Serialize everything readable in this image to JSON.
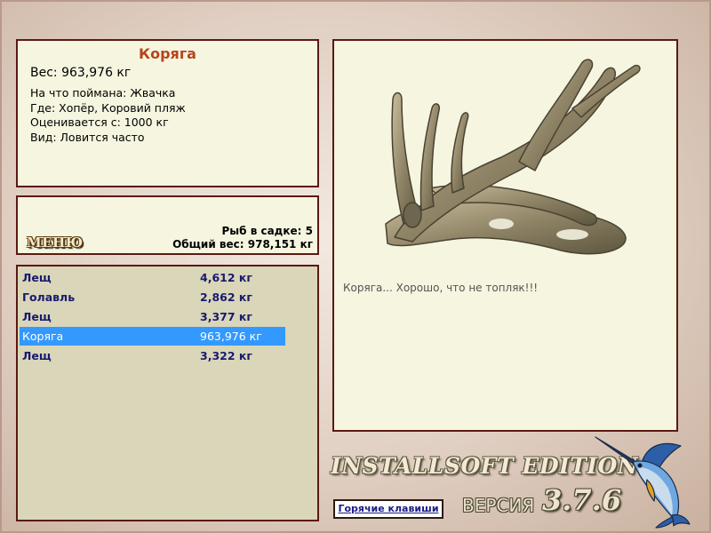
{
  "catch": {
    "title": "Коряга",
    "weight": "Вес: 963,976 кг",
    "caught_on": "На что поймана: Жвачка",
    "location": "Где: Хопёр, Коровий пляж",
    "value": "Оценивается с: 1000 кг",
    "kind": "Вид: Ловится часто"
  },
  "stats": {
    "menu_label": "МЕНЮ",
    "fish_count": "Рыб в садке: 5",
    "total_weight": "Общий вес: 978,151 кг"
  },
  "fish_list": [
    {
      "name": "Лещ",
      "weight": "4,612 кг",
      "selected": false
    },
    {
      "name": "Голавль",
      "weight": "2,862 кг",
      "selected": false
    },
    {
      "name": "Лещ",
      "weight": "3,377 кг",
      "selected": false
    },
    {
      "name": "Коряга",
      "weight": "963,976 кг",
      "selected": true
    },
    {
      "name": "Лещ",
      "weight": "3,322 кг",
      "selected": false
    }
  ],
  "picture": {
    "description": "Коряга... Хорошо, что не топляк!!!",
    "image_icon": "driftwood-image"
  },
  "footer": {
    "brand": "INSTALLSOFT EDITION",
    "hotkeys_label": "Горячие клавиши",
    "version_label": "ВЕРСИЯ",
    "version_number": "3.7.6",
    "logo_icon": "marlin-icon"
  },
  "colors": {
    "panel_border": "#5a1a12",
    "panel_bg": "#f5f5e0",
    "list_bg": "#d9d6b9",
    "selected_row": "#3399ff",
    "title_color": "#b8441c",
    "list_text": "#1a1a6e"
  }
}
